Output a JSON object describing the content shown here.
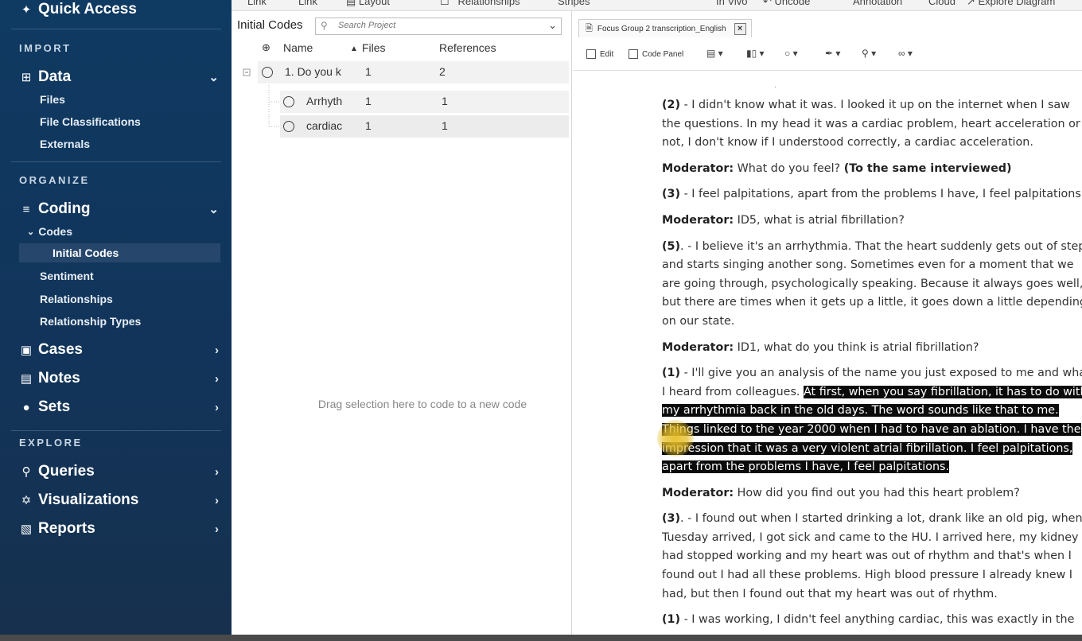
{
  "sidebar": {
    "quick_access": "Quick Access",
    "sections": {
      "import": "IMPORT",
      "organize": "ORGANIZE",
      "explore": "EXPLORE"
    },
    "data": {
      "label": "Data",
      "items": [
        "Files",
        "File Classifications",
        "Externals"
      ]
    },
    "coding": {
      "label": "Coding",
      "codes_label": "Codes",
      "selected_child": "Initial Codes",
      "items": [
        "Sentiment",
        "Relationships",
        "Relationship Types"
      ]
    },
    "cases": "Cases",
    "notes": "Notes",
    "sets": "Sets",
    "queries": "Queries",
    "visualizations": "Visualizations",
    "reports": "Reports"
  },
  "ribbon": {
    "items": [
      "Link",
      "Link",
      "Layout",
      "Relationships",
      "Stripes",
      "In Vivo",
      "Uncode",
      "Annotation",
      "Cloud",
      "Explore Diagram"
    ]
  },
  "codes_panel": {
    "title": "Initial Codes",
    "search_placeholder": "Search Project",
    "columns": {
      "name": "Name",
      "files": "Files",
      "references": "References"
    },
    "rows": [
      {
        "name": "1. Do you k",
        "files": "1",
        "references": "2"
      },
      {
        "name": "Arrhyth",
        "files": "1",
        "references": "1"
      },
      {
        "name": "cardiac",
        "files": "1",
        "references": "1"
      }
    ],
    "drag_hint": "Drag selection here to code to a new code"
  },
  "document": {
    "tab_title": "Focus Group 2 transcription_English",
    "toolbar": {
      "edit": "Edit",
      "code_panel": "Code Panel"
    },
    "paragraphs": {
      "p1": {
        "prefix": "(2)",
        "lines": [
          " - I didn't know what it was. I looked it up on the internet when I saw",
          "the questions. In my head it was a cardiac problem, heart acceleration or",
          "not, I don't know if I understood correctly, a cardiac acceleration."
        ]
      },
      "p2": {
        "speaker": "Moderator:",
        "text": " What do you feel? ",
        "bold_tail": "(To the same interviewed)"
      },
      "p3": {
        "prefix": "(3)",
        "text": " - I feel palpitations, apart from the problems I have, I feel palpitations."
      },
      "p4": {
        "speaker": "Moderator:",
        "text": " ID5, what is atrial fibrillation?"
      },
      "p5": {
        "prefix": "(5)",
        "lines": [
          ". - I believe it's an arrhythmia. That the heart suddenly gets out of step",
          "and starts singing another song. Sometimes even for a moment that we",
          "are going through, psychologically speaking. Because it always goes well,",
          "but there are times when it gets up a little, it goes down a little depending",
          "on our state."
        ]
      },
      "p6": {
        "speaker": "Moderator:",
        "text": " ID1, what do you think is atrial fibrillation?"
      },
      "p7": {
        "prefix": "(1)",
        "line1": " - I'll give you an analysis of the name you just exposed to me and what",
        "line2_plain": "I heard from colleagues. ",
        "line2_hl": "At first, when you say fibrillation, it has to do with",
        "hl_lines": [
          "my arrhythmia back in the old days. The word sounds like that to me.",
          "Things linked to the year 2000 when I had to have an ablation. I have the",
          "impression that it was a very violent atrial fibrillation. I feel palpitations,",
          "apart from the problems I have, I feel palpitations."
        ]
      },
      "p8": {
        "speaker": "Moderator:",
        "text": " How did you find out you had this heart problem?"
      },
      "p9": {
        "prefix": "(3)",
        "lines": [
          ". - I found out when I started drinking a lot, drank like an old pig, when",
          "Tuesday arrived, I got sick and came to the HU. I arrived here, my kidney",
          "had stopped working and my heart was out of rhythm and that's when I",
          "found out I had all these problems. High blood pressure I already knew I",
          "had, but then I found out that my heart was out of rhythm."
        ]
      },
      "p10": {
        "prefix": "(1)",
        "text": " - I was working, I didn't feel anything cardiac, this was exactly in the"
      }
    }
  }
}
